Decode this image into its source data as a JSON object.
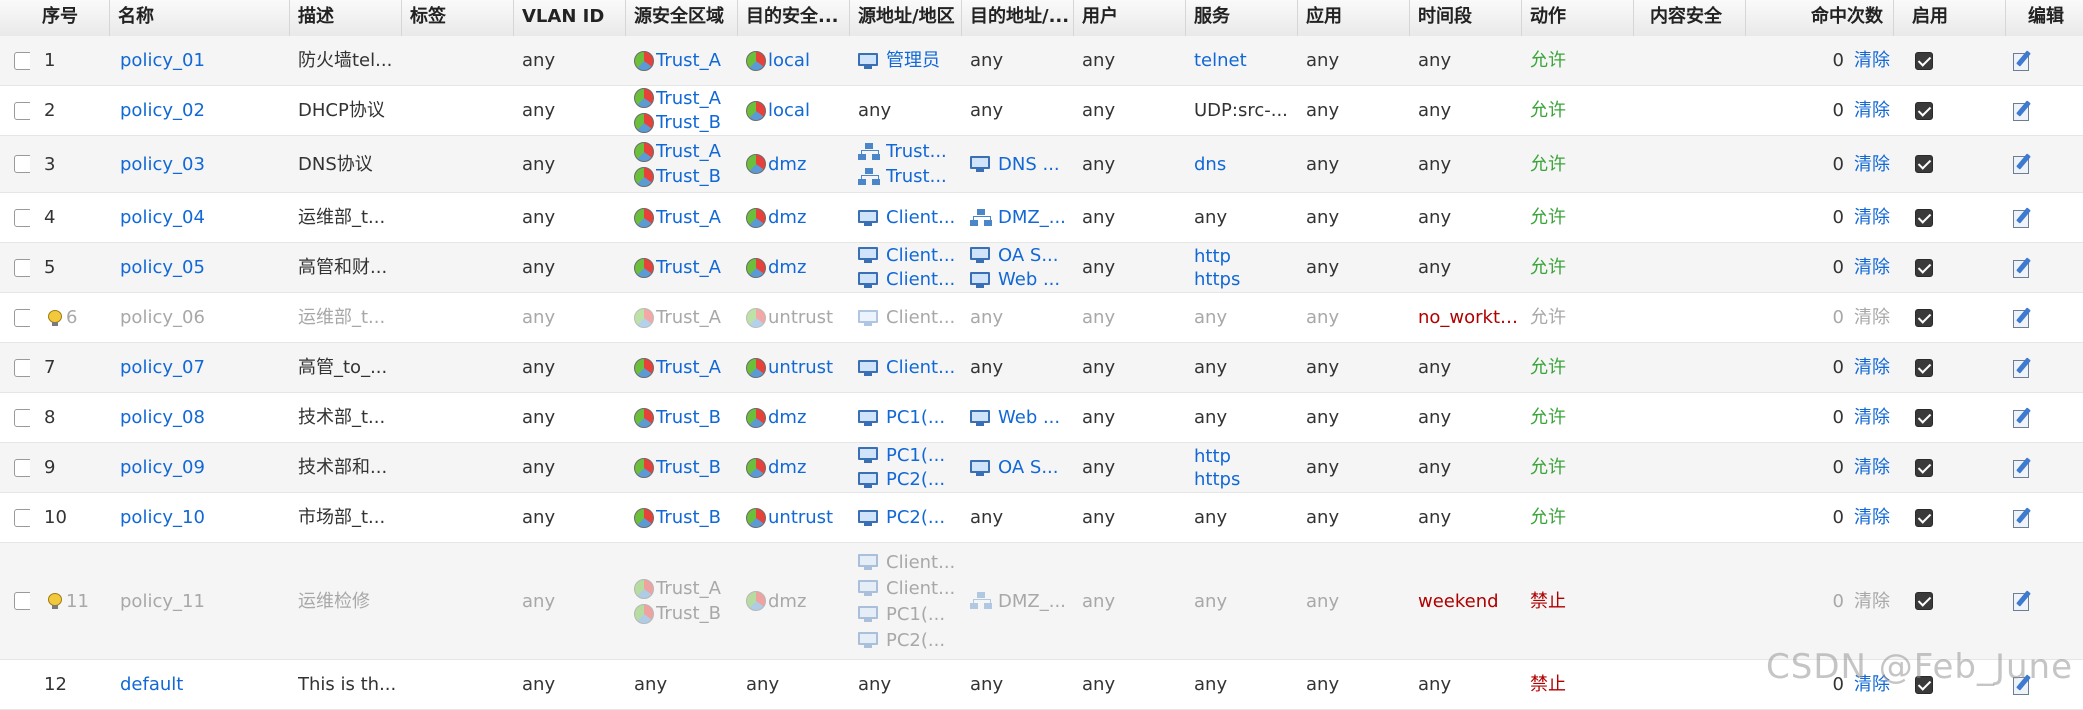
{
  "headers": {
    "seq": "序号",
    "name": "名称",
    "desc": "描述",
    "tag": "标签",
    "vlan": "VLAN ID",
    "src_zone": "源安全区域",
    "dst_zone": "目的安全...",
    "src_addr": "源地址/地区",
    "dst_addr": "目的地址/...",
    "user": "用户",
    "service": "服务",
    "app": "应用",
    "time": "时间段",
    "action": "动作",
    "content": "内容安全",
    "hits": "命中次数",
    "enable": "启用",
    "edit": "编辑"
  },
  "rows": [
    {
      "seq": "1",
      "name": "policy_01",
      "desc": "防火墙tel...",
      "vlan": "any",
      "src_zone": [
        "Trust_A"
      ],
      "dst_zone": [
        "local"
      ],
      "src_addr": [
        {
          "icon": "monitor-icon",
          "text": "管理员"
        }
      ],
      "dst_addr": [
        {
          "text": "any"
        }
      ],
      "user": "any",
      "service": [
        {
          "text": "telnet",
          "link": true
        }
      ],
      "app": "any",
      "time": "any",
      "action": "允许",
      "hits": "0",
      "clear": "清除",
      "enabled": true,
      "disabled": false,
      "warning": false
    },
    {
      "seq": "2",
      "name": "policy_02",
      "desc": "DHCP协议",
      "vlan": "any",
      "src_zone": [
        "Trust_A",
        "Trust_B"
      ],
      "dst_zone": [
        "local"
      ],
      "src_addr": [
        {
          "text": "any"
        }
      ],
      "dst_addr": [
        {
          "text": "any"
        }
      ],
      "user": "any",
      "service": [
        {
          "text": "UDP:src-...",
          "link": false
        }
      ],
      "app": "any",
      "time": "any",
      "action": "允许",
      "hits": "0",
      "clear": "清除",
      "enabled": true,
      "disabled": false,
      "warning": false
    },
    {
      "seq": "3",
      "name": "policy_03",
      "desc": "DNS协议",
      "vlan": "any",
      "src_zone": [
        "Trust_A",
        "Trust_B"
      ],
      "dst_zone": [
        "dmz"
      ],
      "src_addr": [
        {
          "icon": "network-icon",
          "text": "Trust..."
        },
        {
          "icon": "network-icon",
          "text": "Trust..."
        }
      ],
      "dst_addr": [
        {
          "icon": "monitor-icon",
          "text": "DNS ..."
        }
      ],
      "user": "any",
      "service": [
        {
          "text": "dns",
          "link": true
        }
      ],
      "app": "any",
      "time": "any",
      "action": "允许",
      "hits": "0",
      "clear": "清除",
      "enabled": true,
      "disabled": false,
      "warning": false
    },
    {
      "seq": "4",
      "name": "policy_04",
      "desc": "运维部_t...",
      "vlan": "any",
      "src_zone": [
        "Trust_A"
      ],
      "dst_zone": [
        "dmz"
      ],
      "src_addr": [
        {
          "icon": "monitor-icon",
          "text": "Client..."
        }
      ],
      "dst_addr": [
        {
          "icon": "network-icon",
          "text": "DMZ_..."
        }
      ],
      "user": "any",
      "service": [
        {
          "text": "any",
          "link": false
        }
      ],
      "app": "any",
      "time": "any",
      "action": "允许",
      "hits": "0",
      "clear": "清除",
      "enabled": true,
      "disabled": false,
      "warning": false
    },
    {
      "seq": "5",
      "name": "policy_05",
      "desc": "高管和财...",
      "vlan": "any",
      "src_zone": [
        "Trust_A"
      ],
      "dst_zone": [
        "dmz"
      ],
      "src_addr": [
        {
          "icon": "monitor-icon",
          "text": "Client..."
        },
        {
          "icon": "monitor-icon",
          "text": "Client..."
        }
      ],
      "dst_addr": [
        {
          "icon": "monitor-icon",
          "text": "OA S..."
        },
        {
          "icon": "monitor-icon",
          "text": "Web ..."
        }
      ],
      "user": "any",
      "service": [
        {
          "text": "http",
          "link": true
        },
        {
          "text": "https",
          "link": true
        }
      ],
      "app": "any",
      "time": "any",
      "action": "允许",
      "hits": "0",
      "clear": "清除",
      "enabled": true,
      "disabled": false,
      "warning": false
    },
    {
      "seq": "6",
      "name": "policy_06",
      "desc": "运维部_t...",
      "vlan": "any",
      "src_zone": [
        "Trust_A"
      ],
      "dst_zone": [
        "untrust"
      ],
      "src_addr": [
        {
          "icon": "monitor-icon",
          "text": "Client..."
        }
      ],
      "dst_addr": [
        {
          "text": "any"
        }
      ],
      "user": "any",
      "service": [
        {
          "text": "any",
          "link": false
        }
      ],
      "app": "any",
      "time": "no_workti...",
      "action": "允许",
      "hits": "0",
      "clear": "清除",
      "enabled": true,
      "disabled": true,
      "warning": true
    },
    {
      "seq": "7",
      "name": "policy_07",
      "desc": "高管_to_...",
      "vlan": "any",
      "src_zone": [
        "Trust_A"
      ],
      "dst_zone": [
        "untrust"
      ],
      "src_addr": [
        {
          "icon": "monitor-icon",
          "text": "Client..."
        }
      ],
      "dst_addr": [
        {
          "text": "any"
        }
      ],
      "user": "any",
      "service": [
        {
          "text": "any",
          "link": false
        }
      ],
      "app": "any",
      "time": "any",
      "action": "允许",
      "hits": "0",
      "clear": "清除",
      "enabled": true,
      "disabled": false,
      "warning": false
    },
    {
      "seq": "8",
      "name": "policy_08",
      "desc": "技术部_t...",
      "vlan": "any",
      "src_zone": [
        "Trust_B"
      ],
      "dst_zone": [
        "dmz"
      ],
      "src_addr": [
        {
          "icon": "monitor-icon",
          "text": "PC1(..."
        }
      ],
      "dst_addr": [
        {
          "icon": "monitor-icon",
          "text": "Web ..."
        }
      ],
      "user": "any",
      "service": [
        {
          "text": "any",
          "link": false
        }
      ],
      "app": "any",
      "time": "any",
      "action": "允许",
      "hits": "0",
      "clear": "清除",
      "enabled": true,
      "disabled": false,
      "warning": false
    },
    {
      "seq": "9",
      "name": "policy_09",
      "desc": "技术部和...",
      "vlan": "any",
      "src_zone": [
        "Trust_B"
      ],
      "dst_zone": [
        "dmz"
      ],
      "src_addr": [
        {
          "icon": "monitor-icon",
          "text": "PC1(..."
        },
        {
          "icon": "monitor-icon",
          "text": "PC2(..."
        }
      ],
      "dst_addr": [
        {
          "icon": "monitor-icon",
          "text": "OA S..."
        }
      ],
      "user": "any",
      "service": [
        {
          "text": "http",
          "link": true
        },
        {
          "text": "https",
          "link": true
        }
      ],
      "app": "any",
      "time": "any",
      "action": "允许",
      "hits": "0",
      "clear": "清除",
      "enabled": true,
      "disabled": false,
      "warning": false
    },
    {
      "seq": "10",
      "name": "policy_10",
      "desc": "市场部_t...",
      "vlan": "any",
      "src_zone": [
        "Trust_B"
      ],
      "dst_zone": [
        "untrust"
      ],
      "src_addr": [
        {
          "icon": "monitor-icon",
          "text": "PC2(..."
        }
      ],
      "dst_addr": [
        {
          "text": "any"
        }
      ],
      "user": "any",
      "service": [
        {
          "text": "any",
          "link": false
        }
      ],
      "app": "any",
      "time": "any",
      "action": "允许",
      "hits": "0",
      "clear": "清除",
      "enabled": true,
      "disabled": false,
      "warning": false
    },
    {
      "seq": "11",
      "name": "policy_11",
      "desc": "运维检修",
      "vlan": "any",
      "src_zone": [
        "Trust_A",
        "Trust_B"
      ],
      "dst_zone": [
        "dmz"
      ],
      "src_addr": [
        {
          "icon": "monitor-icon",
          "text": "Client..."
        },
        {
          "icon": "monitor-icon",
          "text": "Client..."
        },
        {
          "icon": "monitor-icon",
          "text": "PC1(..."
        },
        {
          "icon": "monitor-icon",
          "text": "PC2(..."
        }
      ],
      "dst_addr": [
        {
          "icon": "network-icon",
          "text": "DMZ_..."
        }
      ],
      "user": "any",
      "service": [
        {
          "text": "any",
          "link": false
        }
      ],
      "app": "any",
      "time": "weekend",
      "action": "禁止",
      "hits": "0",
      "clear": "清除",
      "enabled": true,
      "disabled": true,
      "warning": true
    },
    {
      "seq": "12",
      "name": "default",
      "desc": "This is th...",
      "vlan": "any",
      "src_zone_text": "any",
      "dst_zone_text": "any",
      "src_addr": [
        {
          "text": "any"
        }
      ],
      "dst_addr": [
        {
          "text": "any"
        }
      ],
      "user": "any",
      "service": [
        {
          "text": "any",
          "link": false
        }
      ],
      "app": "any",
      "time": "any",
      "action": "禁止",
      "hits": "0",
      "clear": "清除",
      "enabled": true,
      "disabled": false,
      "warning": false,
      "is_default": true
    }
  ],
  "watermark": "CSDN @Feb_June",
  "colors": {
    "link": "#1168d6",
    "allow": "#3aa43a",
    "deny": "#b00000",
    "disabled": "#a8a8a8"
  }
}
